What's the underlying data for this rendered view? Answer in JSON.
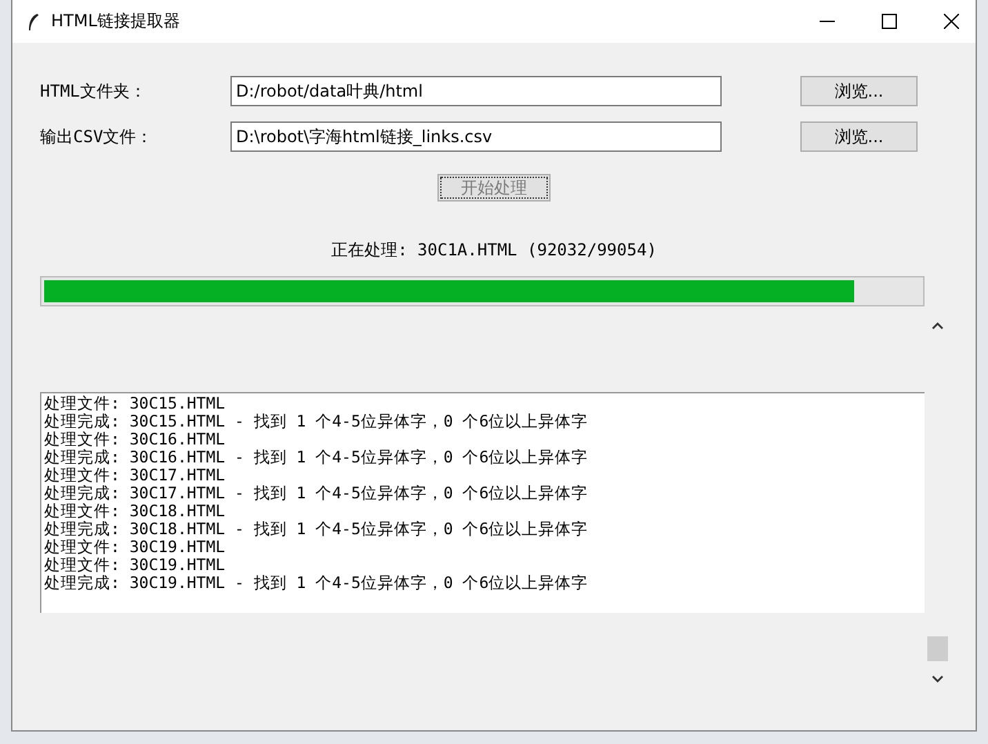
{
  "window": {
    "title": "HTML链接提取器"
  },
  "fields": [
    {
      "label": "HTML文件夹：",
      "value": "D:/robot/data叶典/html",
      "button": "浏览..."
    },
    {
      "label": "输出CSV文件：",
      "value": "D:\\robot\\字海html链接_links.csv",
      "button": "浏览..."
    }
  ],
  "start_button": {
    "label": "开始处理",
    "disabled": true
  },
  "status": "正在处理: 30C1A.HTML (92032/99054)",
  "progress": {
    "level": 0.925
  },
  "log": [
    "处理文件: 30C15.HTML",
    "处理完成: 30C15.HTML - 找到 1 个4-5位异体字，0 个6位以上异体字",
    "处理文件: 30C16.HTML",
    "处理完成: 30C16.HTML - 找到 1 个4-5位异体字，0 个6位以上异体字",
    "处理文件: 30C17.HTML",
    "处理完成: 30C17.HTML - 找到 1 个4-5位异体字，0 个6位以上异体字",
    "处理文件: 30C18.HTML",
    "处理完成: 30C18.HTML - 找到 1 个4-5位异体字，0 个6位以上异体字",
    "处理文件: 30C19.HTML",
    "处理文件: 30C19.HTML",
    "处理完成: 30C19.HTML - 找到 1 个4-5位异体字，0 个6位以上异体字"
  ]
}
